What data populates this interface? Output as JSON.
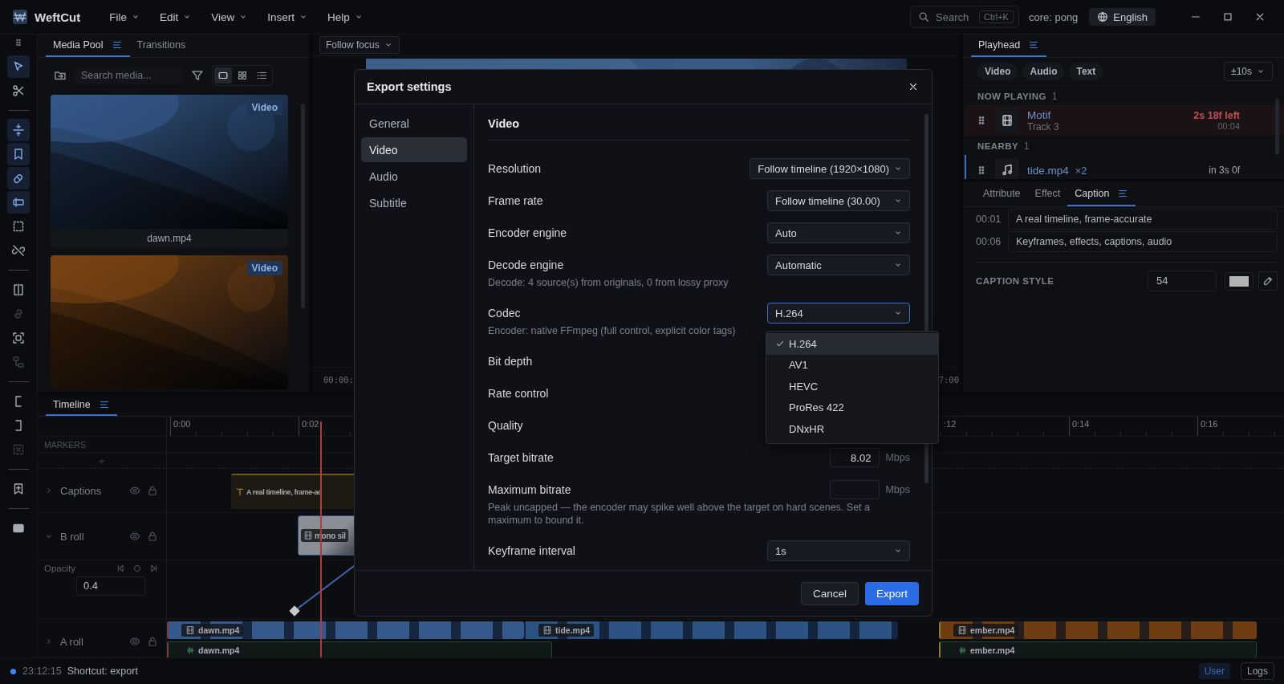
{
  "app": {
    "name": "WeftCut",
    "menus": [
      "File",
      "Edit",
      "View",
      "Insert",
      "Help"
    ]
  },
  "titlebar": {
    "search": {
      "placeholder": "Search",
      "shortcut": "Ctrl+K"
    },
    "core_status": "core: pong",
    "language": "English"
  },
  "tool_groups": [
    [
      {
        "kind": "cursor",
        "on": true,
        "disabled": false
      },
      {
        "kind": "scissors",
        "on": false,
        "disabled": false
      }
    ],
    [
      {
        "kind": "snap",
        "on": true,
        "disabled": false
      },
      {
        "kind": "bookmark",
        "on": true,
        "disabled": false
      },
      {
        "kind": "magnet",
        "on": true,
        "disabled": false
      },
      {
        "kind": "slip",
        "on": true,
        "disabled": false
      },
      {
        "kind": "marquee",
        "on": false,
        "disabled": false
      },
      {
        "kind": "unlink",
        "on": false,
        "disabled": false
      }
    ],
    [
      {
        "kind": "split",
        "on": false,
        "disabled": false
      },
      {
        "kind": "link",
        "on": false,
        "disabled": true
      },
      {
        "kind": "scan",
        "on": false,
        "disabled": false
      },
      {
        "kind": "group",
        "on": false,
        "disabled": true
      }
    ],
    [
      {
        "kind": "in",
        "on": false,
        "disabled": false
      },
      {
        "kind": "out",
        "on": false,
        "disabled": false
      },
      {
        "kind": "xbox",
        "on": false,
        "disabled": true
      }
    ],
    [
      {
        "kind": "addmark",
        "on": false,
        "disabled": false
      }
    ],
    [
      {
        "kind": "monitor",
        "on": false,
        "disabled": false
      }
    ]
  ],
  "media_pool": {
    "tabs": [
      {
        "label": "Media Pool",
        "selected": true
      },
      {
        "label": "Transitions",
        "selected": false
      }
    ],
    "search": {
      "placeholder": "Search media..."
    },
    "views": [
      {
        "kind": "single",
        "selected": true
      },
      {
        "kind": "grid",
        "selected": false
      },
      {
        "kind": "list",
        "selected": false
      }
    ],
    "items": [
      {
        "kind": "picture",
        "badge": "Video",
        "name": "dawn.mp4",
        "color": "#35598a"
      },
      {
        "kind": "picture",
        "badge": "Video",
        "color": "#7a4414"
      }
    ]
  },
  "preview": {
    "follow": "Follow focus",
    "timecode": "00:00:",
    "duration": "7:00"
  },
  "inspector": {
    "tabs": [
      {
        "label": "Playhead",
        "selected": true
      }
    ],
    "filters": [
      {
        "label": "Video"
      },
      {
        "label": "Audio"
      },
      {
        "label": "Text"
      }
    ],
    "range": "±10s",
    "sections": [
      {
        "title": "NOW PLAYING",
        "count": "1",
        "items": [
          {
            "kind": "video",
            "playing": true,
            "name": "Motif",
            "sub": "Track 3",
            "remaining": "2s 18f left",
            "time": "00:04"
          }
        ]
      },
      {
        "title": "NEARBY",
        "count": "1",
        "items": [
          {
            "kind": "audio",
            "playing": false,
            "name": "tide.mp4",
            "multiplier": "×2",
            "time": "in 3s 0f"
          }
        ]
      }
    ]
  },
  "properties": {
    "tabs": [
      {
        "label": "Attribute",
        "selected": false
      },
      {
        "label": "Effect",
        "selected": false
      },
      {
        "label": "Caption",
        "selected": true
      }
    ],
    "captions": [
      {
        "time": "00:01",
        "text": "A real timeline, frame-accurate"
      },
      {
        "time": "00:06",
        "text": "Keyframes, effects, captions, audio"
      }
    ],
    "style": {
      "label": "CAPTION STYLE",
      "size": "54",
      "color": "#b4b4b4"
    }
  },
  "timeline": {
    "tab": "Timeline",
    "ruler_start": [
      "0:00",
      "0:02"
    ],
    "ruler_end": [
      ":12",
      "0:14",
      "0:16"
    ],
    "markers": {
      "label": "MARKERS",
      "add": "+"
    },
    "tracks": [
      {
        "kind": "caption",
        "name": "Captions",
        "expanded": false,
        "clips": [
          {
            "label": "A real timeline, frame-ac"
          }
        ]
      },
      {
        "kind": "video",
        "name": "B roll",
        "expanded": true,
        "clips": [
          {
            "label": "mono sil"
          }
        ]
      },
      {
        "kind": "automation",
        "name": "Opacity",
        "value": "0.4"
      },
      {
        "kind": "av",
        "name": "A roll",
        "expanded": false,
        "clips": [
          {
            "label": "dawn.mp4",
            "color": "#35598a"
          },
          {
            "label": "tide.mp4",
            "color": "#2b5282"
          },
          {
            "label": "ember.mp4",
            "color": "#6e3d12"
          }
        ],
        "audio": [
          {
            "label": "dawn.mp4"
          },
          {
            "label": "ember.mp4"
          }
        ]
      }
    ]
  },
  "status_bar": {
    "time": "23:12:15",
    "message": "Shortcut: export",
    "buttons": [
      {
        "label": "User",
        "selected": true
      },
      {
        "label": "Logs",
        "selected": false
      }
    ]
  },
  "export_dialog": {
    "title": "Export settings",
    "nav": [
      {
        "label": "General",
        "selected": false
      },
      {
        "label": "Video",
        "selected": true
      },
      {
        "label": "Audio",
        "selected": false
      },
      {
        "label": "Subtitle",
        "selected": false
      }
    ],
    "section": "Video",
    "rows": [
      {
        "kind": "select",
        "label": "Resolution",
        "value": "Follow timeline (1920×1080)",
        "open": false
      },
      {
        "kind": "select",
        "label": "Frame rate",
        "value": "Follow timeline (30.00)",
        "open": false
      },
      {
        "kind": "select",
        "label": "Encoder engine",
        "value": "Auto",
        "open": false
      },
      {
        "kind": "select",
        "label": "Decode engine",
        "value": "Automatic",
        "open": false,
        "hint": "Decode: 4 source(s) from originals, 0 from lossy proxy"
      },
      {
        "kind": "select",
        "label": "Codec",
        "value": "H.264",
        "open": true,
        "hint": "Encoder: native FFmpeg (full control, explicit color tags)",
        "options": [
          {
            "label": "H.264",
            "selected": true
          },
          {
            "label": "AV1",
            "selected": false
          },
          {
            "label": "HEVC",
            "selected": false
          },
          {
            "label": "ProRes 422",
            "selected": false
          },
          {
            "label": "DNxHR",
            "selected": false
          }
        ]
      },
      {
        "kind": "covered",
        "label": "Bit depth"
      },
      {
        "kind": "covered",
        "label": "Rate control"
      },
      {
        "kind": "covered",
        "label": "Quality"
      },
      {
        "kind": "number",
        "label": "Target bitrate",
        "value": "8.02",
        "unit": "Mbps"
      },
      {
        "kind": "number",
        "label": "Maximum bitrate",
        "unit": "Mbps",
        "hint": "Peak uncapped — the encoder may spike well above the target on hard scenes. Set a maximum to bound it."
      },
      {
        "kind": "select",
        "label": "Keyframe interval",
        "value": "1s",
        "open": false
      }
    ],
    "buttons": [
      {
        "kind": "secondary",
        "label": "Cancel"
      },
      {
        "kind": "primary",
        "label": "Export"
      }
    ]
  }
}
